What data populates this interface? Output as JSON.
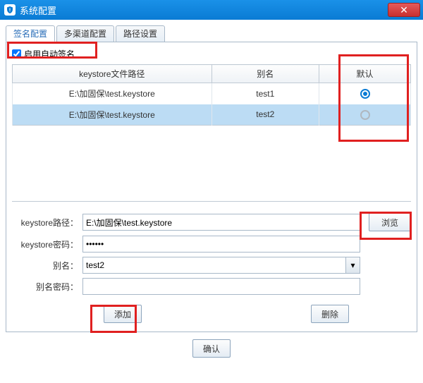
{
  "titlebar": {
    "title": "系统配置"
  },
  "tabs": [
    {
      "label": "签名配置",
      "active": true
    },
    {
      "label": "多渠道配置",
      "active": false
    },
    {
      "label": "路径设置",
      "active": false
    }
  ],
  "auto_sign": {
    "label": "启用自动签名",
    "checked": true
  },
  "table": {
    "headers": {
      "path": "keystore文件路径",
      "alias": "别名",
      "default": "默认"
    },
    "rows": [
      {
        "path": "E:\\加固保\\test.keystore",
        "alias": "test1",
        "default": true,
        "selected": false
      },
      {
        "path": "E:\\加固保\\test.keystore",
        "alias": "test2",
        "default": false,
        "selected": true
      }
    ]
  },
  "form": {
    "path_label": "keystore路径：",
    "path_value": "E:\\加固保\\test.keystore",
    "browse": "浏览",
    "pwd_label": "keystore密码：",
    "pwd_value": "••••••",
    "alias_label": "别名：",
    "alias_value": "test2",
    "alias_pwd_label": "别名密码："
  },
  "buttons": {
    "add": "添加",
    "delete": "删除",
    "confirm": "确认"
  }
}
